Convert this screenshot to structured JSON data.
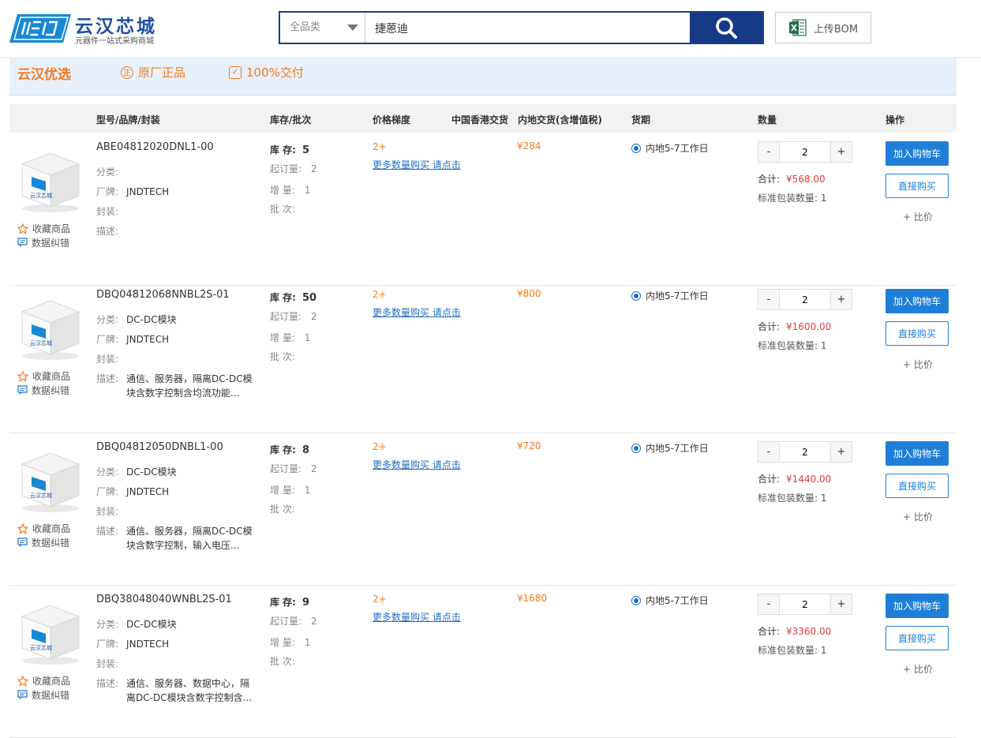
{
  "header": {
    "logo_title": "云汉芯城",
    "logo_sub": "元器件一站式采购商城",
    "search_category": "全品类",
    "search_query": "捷蒽迪",
    "bom_label": "上传BOM"
  },
  "banner": {
    "title": "云汉优选",
    "badges": [
      "原厂正品",
      "100%交付"
    ],
    "badge_icons": [
      "正",
      "✓"
    ]
  },
  "table_headers": {
    "model": "型号/品牌/封装",
    "stock": "库存/批次",
    "price_tier": "价格梯度",
    "hk": "中国香港交货",
    "mainland": "内地交货(含增值税)",
    "lead": "货期",
    "qty": "数量",
    "ops": "操作"
  },
  "labels": {
    "favorite": "收藏商品",
    "report": "数据纠错",
    "category": "分类:",
    "brand": "厂牌:",
    "package": "封装:",
    "desc": "描述:",
    "stock": "库  存:",
    "moq": "起订量:",
    "increment": "增  量:",
    "batch": "批  次:",
    "tier": "2+",
    "more": "更多数量购买 请点击",
    "total": "合计:",
    "pack": "标准包装数量: 1",
    "cart": "加入购物车",
    "buy": "直接购买",
    "compare": "+ 比价",
    "minus": "-",
    "plus": "+",
    "img_text": "云汉芯城"
  },
  "products": [
    {
      "pn": "ABE04812020DNL1-00",
      "category": "",
      "brand": "JNDTECH",
      "package": "",
      "desc": "",
      "stock": "5",
      "moq": "2",
      "increment": "1",
      "batch": "",
      "price": "¥284",
      "lead": "内地5-7工作日",
      "qty": "2",
      "total": "¥568.00"
    },
    {
      "pn": "DBQ04812068NNBL2S-01",
      "category": "DC-DC模块",
      "brand": "JNDTECH",
      "package": "",
      "desc": "通信、服务器，隔离DC-DC模块含数字控制含均流功能...",
      "stock": "50",
      "moq": "2",
      "increment": "1",
      "batch": "",
      "price": "¥800",
      "lead": "内地5-7工作日",
      "qty": "2",
      "total": "¥1600.00"
    },
    {
      "pn": "DBQ04812050DNBL1-00",
      "category": "DC-DC模块",
      "brand": "JNDTECH",
      "package": "",
      "desc": "通信、服务器，隔离DC-DC模块含数字控制，输入电压...",
      "stock": "8",
      "moq": "2",
      "increment": "1",
      "batch": "",
      "price": "¥720",
      "lead": "内地5-7工作日",
      "qty": "2",
      "total": "¥1440.00"
    },
    {
      "pn": "DBQ38048040WNBL2S-01",
      "category": "DC-DC模块",
      "brand": "JNDTECH",
      "package": "",
      "desc": "通信、服务器、数据中心，隔离DC-DC模块含数字控制含...",
      "stock": "9",
      "moq": "2",
      "increment": "1",
      "batch": "",
      "price": "¥1680",
      "lead": "内地5-7工作日",
      "qty": "2",
      "total": "¥3360.00"
    }
  ]
}
